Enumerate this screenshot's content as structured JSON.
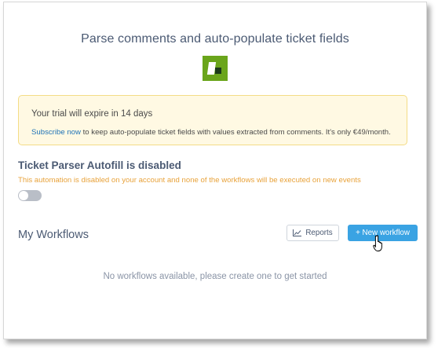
{
  "header": {
    "title": "Parse comments and auto-populate ticket fields",
    "logo_icon": "app-logo-icon",
    "logo_color": "#6aa51b"
  },
  "trial_notice": {
    "heading": "Your trial will expire in 14 days",
    "link_text": "Subscribe now",
    "body_text": " to keep auto-populate ticket fields with values extracted from comments. It's only €49/month.",
    "background_color": "#fff9e3",
    "border_color": "#f4dc86"
  },
  "status": {
    "title": "Ticket Parser Autofill is disabled",
    "description": "This automation is disabled on your account and none of the workflows will be executed on new events",
    "toggle_on": false,
    "warning_color": "#e8a23a"
  },
  "workflows": {
    "title": "My Workflows",
    "reports_label": "Reports",
    "reports_icon": "chart-icon",
    "new_label": "+ New workflow",
    "new_button_color": "#3aa3e3",
    "empty_message": "No workflows available, please create one to get started"
  }
}
